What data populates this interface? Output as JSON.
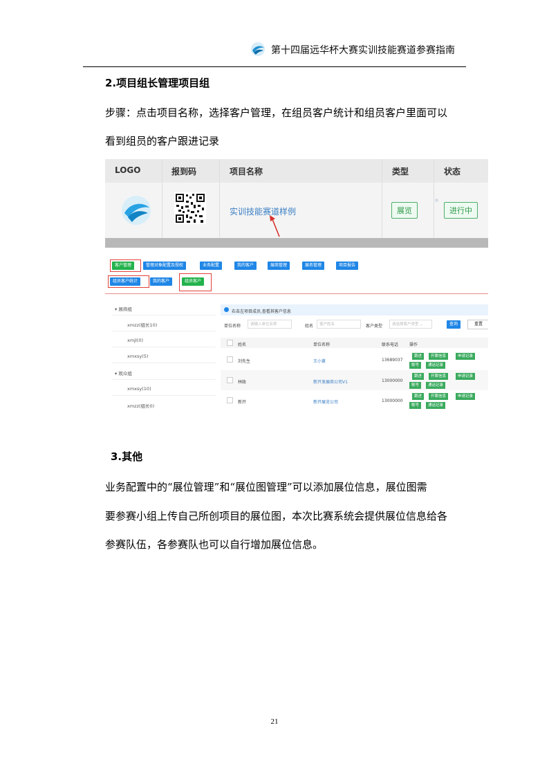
{
  "header": {
    "title": "第十四届远华杯大赛实训技能赛道参赛指南"
  },
  "section2": {
    "title": "2.项目组长管理项目组",
    "para_line1": "步骤：点击项目名称，选择客户管理，在组员客户统计和组员客户里面可以",
    "para_line2": "看到组员的客户跟进记录"
  },
  "shot1": {
    "headers": [
      "LOGO",
      "报到码",
      "项目名称",
      "类型",
      "状态"
    ],
    "project_name": "实训技能赛道样例",
    "type_btn": "展览",
    "status_btn": "进行中"
  },
  "shot2": {
    "tabs_row1": [
      "客户管理",
      "管理对象配置及授权",
      "业务配置",
      "我的客户",
      "展商管理",
      "展务管理",
      "项目报告"
    ],
    "tabs_row2": [
      "组员客户统计",
      "我的客户",
      "组员客户"
    ],
    "tree": [
      "展商组",
      "xmzz(组长10)",
      "xmjl(0)",
      "xmxsy(5)",
      "观众组",
      "xmxsy(10)",
      "xmzz(组长0)"
    ],
    "notice": "右击左项目成员,查看其客户信息",
    "filter": {
      "unit_label": "单位名称",
      "unit_ph": "请输入单位名称",
      "name_label": "姓名",
      "name_ph": "客户姓名",
      "type_label": "客户类型",
      "type_ph": "请选择客户类型",
      "query": "查询",
      "reset": "重置"
    },
    "columns": [
      "姓名",
      "单位名称",
      "联系电话",
      "操作"
    ],
    "rows": [
      {
        "name": "刘先生",
        "unit": "王小黄",
        "phone": "13689037"
      },
      {
        "name": "林政",
        "unit": "新开发展商公司V1",
        "phone": "13000000"
      },
      {
        "name": "新开",
        "unit": "新开展览公司",
        "phone": "13000000"
      }
    ],
    "ops": [
      "跟进",
      "开票信息",
      "申请记录",
      "账号",
      "通话记录"
    ]
  },
  "section3": {
    "title": "3.其他",
    "line1": "业务配置中的“展位管理”和“展位图管理”可以添加展位信息，展位图需",
    "line2": "要参赛小组上传自己所创项目的展位图，本次比赛系统会提供展位信息给各",
    "line3": "参赛队伍，各参赛队也可以自行增加展位信息。"
  },
  "page_number": "21"
}
